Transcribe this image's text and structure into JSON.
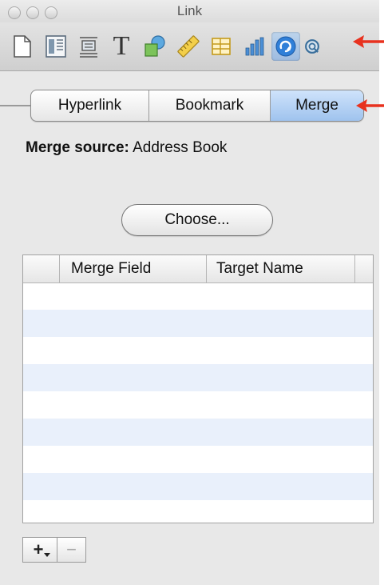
{
  "window": {
    "title": "Link"
  },
  "toolbar": {
    "buttons": [
      {
        "icon": "document-icon"
      },
      {
        "icon": "layout-icon"
      },
      {
        "icon": "wrap-icon"
      },
      {
        "icon": "text-icon",
        "glyph": "T"
      },
      {
        "icon": "graphic-icon"
      },
      {
        "icon": "metrics-icon"
      },
      {
        "icon": "table-icon"
      },
      {
        "icon": "chart-icon"
      },
      {
        "icon": "link-icon",
        "selected": true
      },
      {
        "icon": "quicktime-icon"
      }
    ]
  },
  "tabs": {
    "items": [
      {
        "label": "Hyperlink"
      },
      {
        "label": "Bookmark"
      },
      {
        "label": "Merge",
        "selected": true
      }
    ]
  },
  "merge": {
    "source_label": "Merge source:",
    "source_value": "Address Book",
    "choose_button": "Choose..."
  },
  "table": {
    "columns": [
      "",
      "Merge Field",
      "Target Name",
      ""
    ],
    "rows": []
  },
  "footer": {
    "add_label": "+",
    "remove_label": "−"
  },
  "colors": {
    "accent": "#9fc3ee",
    "row_alt": "#e9f0fb",
    "annotation_arrow": "#e8321f"
  }
}
